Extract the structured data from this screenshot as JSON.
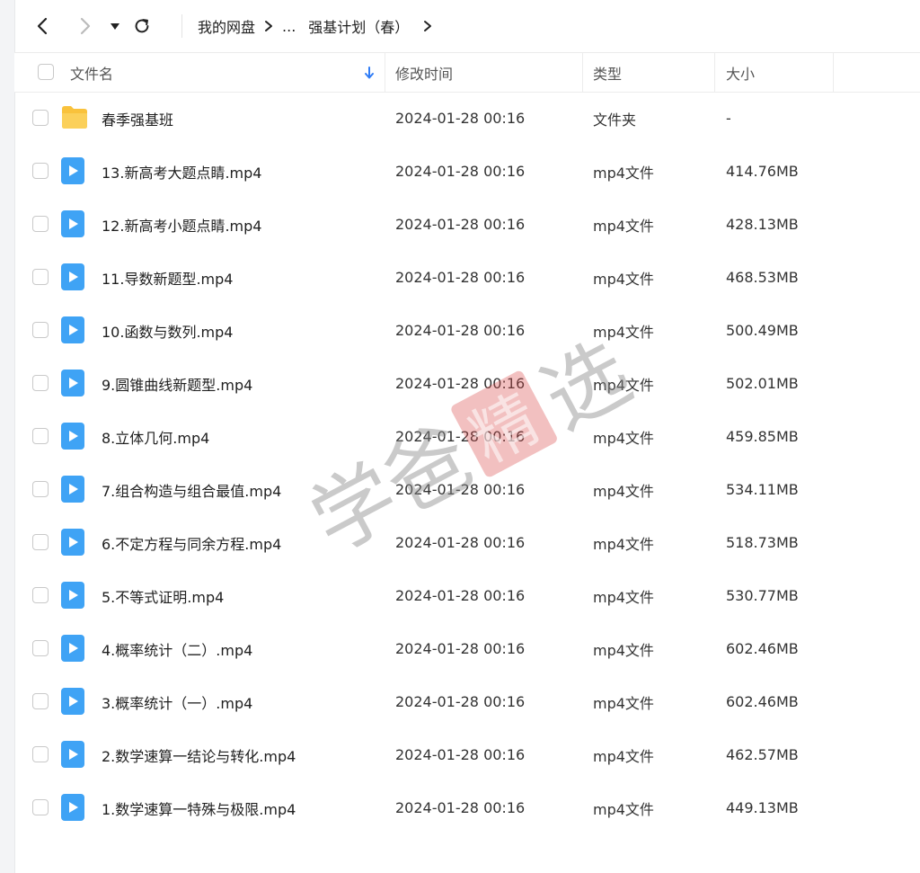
{
  "breadcrumb": {
    "root": "我的网盘",
    "ellipsis": "...",
    "current": "强基计划（春）"
  },
  "columns": {
    "name": "文件名",
    "modified": "修改时间",
    "type": "类型",
    "size": "大小"
  },
  "files": [
    {
      "name": "春季强基班",
      "modified": "2024-01-28 00:16",
      "type": "文件夹",
      "size": "-",
      "icon": "folder-icon"
    },
    {
      "name": "13.新高考大题点睛.mp4",
      "modified": "2024-01-28 00:16",
      "type": "mp4文件",
      "size": "414.76MB",
      "icon": "video-file-icon"
    },
    {
      "name": "12.新高考小题点睛.mp4",
      "modified": "2024-01-28 00:16",
      "type": "mp4文件",
      "size": "428.13MB",
      "icon": "video-file-icon"
    },
    {
      "name": "11.导数新题型.mp4",
      "modified": "2024-01-28 00:16",
      "type": "mp4文件",
      "size": "468.53MB",
      "icon": "video-file-icon"
    },
    {
      "name": "10.函数与数列.mp4",
      "modified": "2024-01-28 00:16",
      "type": "mp4文件",
      "size": "500.49MB",
      "icon": "video-file-icon"
    },
    {
      "name": "9.圆锥曲线新题型.mp4",
      "modified": "2024-01-28 00:16",
      "type": "mp4文件",
      "size": "502.01MB",
      "icon": "video-file-icon"
    },
    {
      "name": "8.立体几何.mp4",
      "modified": "2024-01-28 00:16",
      "type": "mp4文件",
      "size": "459.85MB",
      "icon": "video-file-icon"
    },
    {
      "name": "7.组合构造与组合最值.mp4",
      "modified": "2024-01-28 00:16",
      "type": "mp4文件",
      "size": "534.11MB",
      "icon": "video-file-icon"
    },
    {
      "name": "6.不定方程与同余方程.mp4",
      "modified": "2024-01-28 00:16",
      "type": "mp4文件",
      "size": "518.73MB",
      "icon": "video-file-icon"
    },
    {
      "name": "5.不等式证明.mp4",
      "modified": "2024-01-28 00:16",
      "type": "mp4文件",
      "size": "530.77MB",
      "icon": "video-file-icon"
    },
    {
      "name": "4.概率统计（二）.mp4",
      "modified": "2024-01-28 00:16",
      "type": "mp4文件",
      "size": "602.46MB",
      "icon": "video-file-icon"
    },
    {
      "name": "3.概率统计（一）.mp4",
      "modified": "2024-01-28 00:16",
      "type": "mp4文件",
      "size": "602.46MB",
      "icon": "video-file-icon"
    },
    {
      "name": "2.数学速算一结论与转化.mp4",
      "modified": "2024-01-28 00:16",
      "type": "mp4文件",
      "size": "462.57MB",
      "icon": "video-file-icon"
    },
    {
      "name": "1.数学速算一特殊与极限.mp4",
      "modified": "2024-01-28 00:16",
      "type": "mp4文件",
      "size": "449.13MB",
      "icon": "video-file-icon"
    }
  ],
  "watermark": {
    "text_left": "学爸",
    "seal": "精",
    "text_right": "选"
  },
  "colors": {
    "folder": "#F9C23C",
    "video": "#3FA3F5",
    "sort_arrow": "#2F7CF6",
    "watermark_seal": "#D94A4A"
  }
}
